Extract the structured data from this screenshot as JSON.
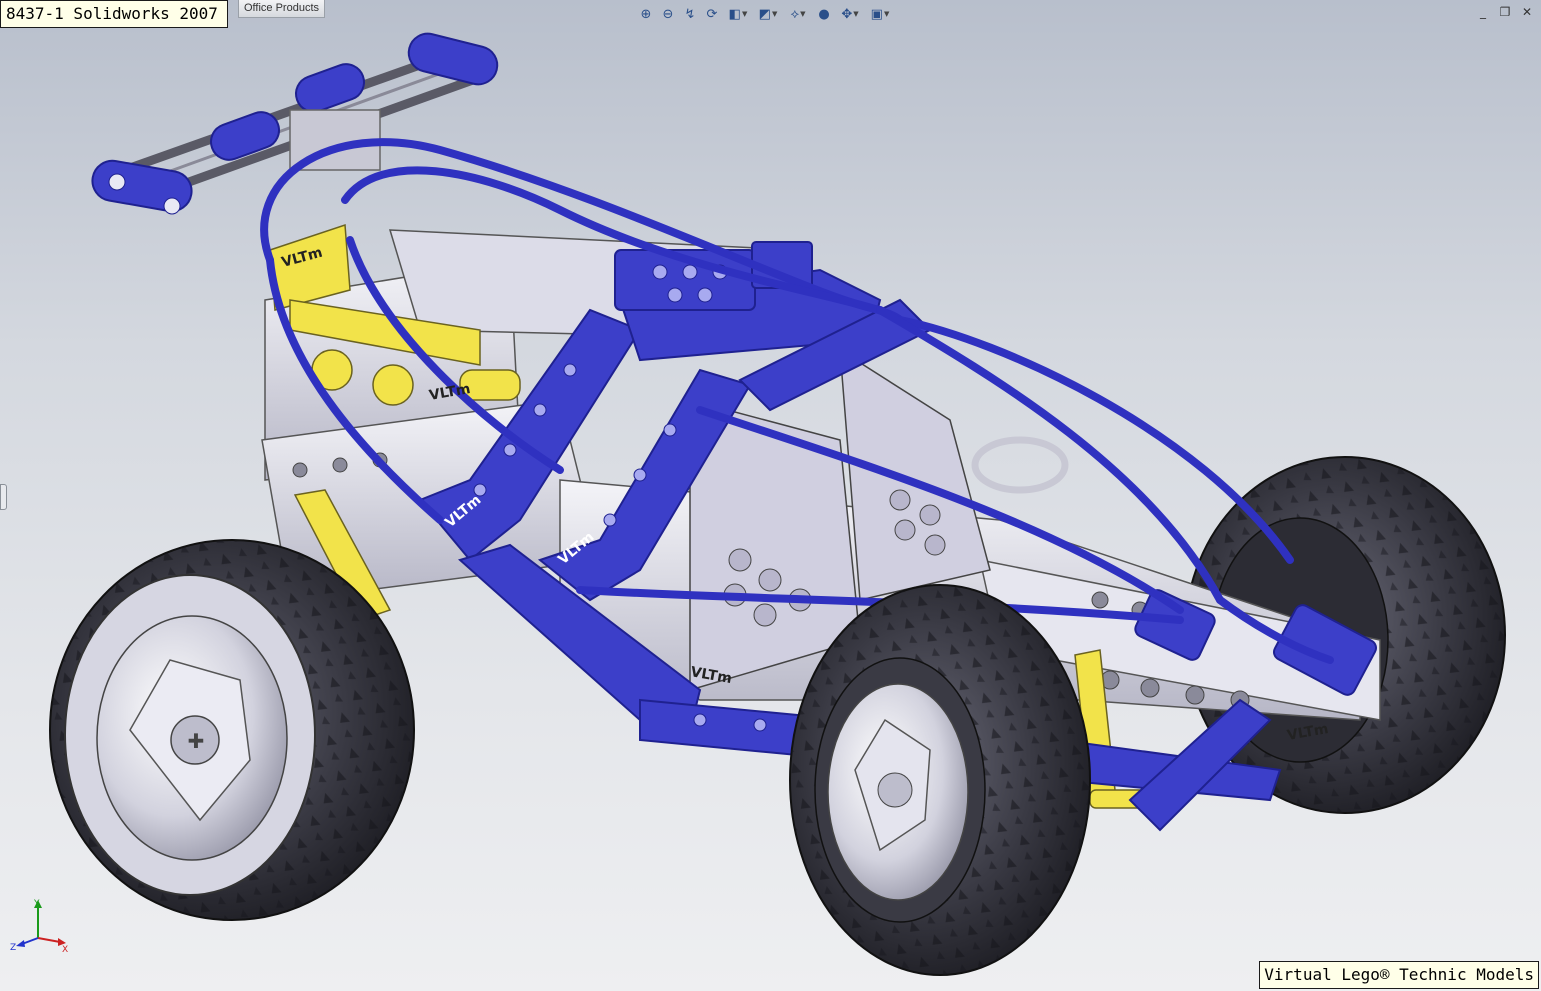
{
  "title": "8437-1 Solidworks 2007",
  "menu": {
    "office_products": "Office Products"
  },
  "view_toolbar": [
    {
      "name": "zoom-to-fit-icon",
      "glyph": "⊕"
    },
    {
      "name": "zoom-to-area-icon",
      "glyph": "⊖"
    },
    {
      "name": "zoom-in-out-icon",
      "glyph": "↯"
    },
    {
      "name": "rotate-view-icon",
      "glyph": "⟳"
    },
    {
      "name": "previous-view-icon",
      "glyph": "◧",
      "dropdown": true
    },
    {
      "name": "section-view-icon",
      "glyph": "◩",
      "dropdown": true
    },
    {
      "name": "view-orientation-icon",
      "glyph": "⟡",
      "dropdown": true
    },
    {
      "name": "display-style-icon",
      "glyph": "●"
    },
    {
      "name": "hide-show-items-icon",
      "glyph": "✥",
      "dropdown": true
    },
    {
      "name": "apply-scene-icon",
      "glyph": "▣",
      "dropdown": true
    }
  ],
  "window_controls": {
    "minimize": "_",
    "restore": "❐",
    "close": "✕"
  },
  "axis": {
    "x": "X",
    "y": "Y",
    "z": "Z"
  },
  "watermark": "Virtual Lego® Technic Models",
  "decal_text": "VLTm",
  "colors": {
    "beam_blue": "#3c3fc9",
    "beam_blue_dark": "#1f2190",
    "tire": "#3a3a44",
    "rim": "#cfd0da",
    "brick_gray": "#d8d8e4",
    "accent_yellow": "#f2e34a"
  }
}
